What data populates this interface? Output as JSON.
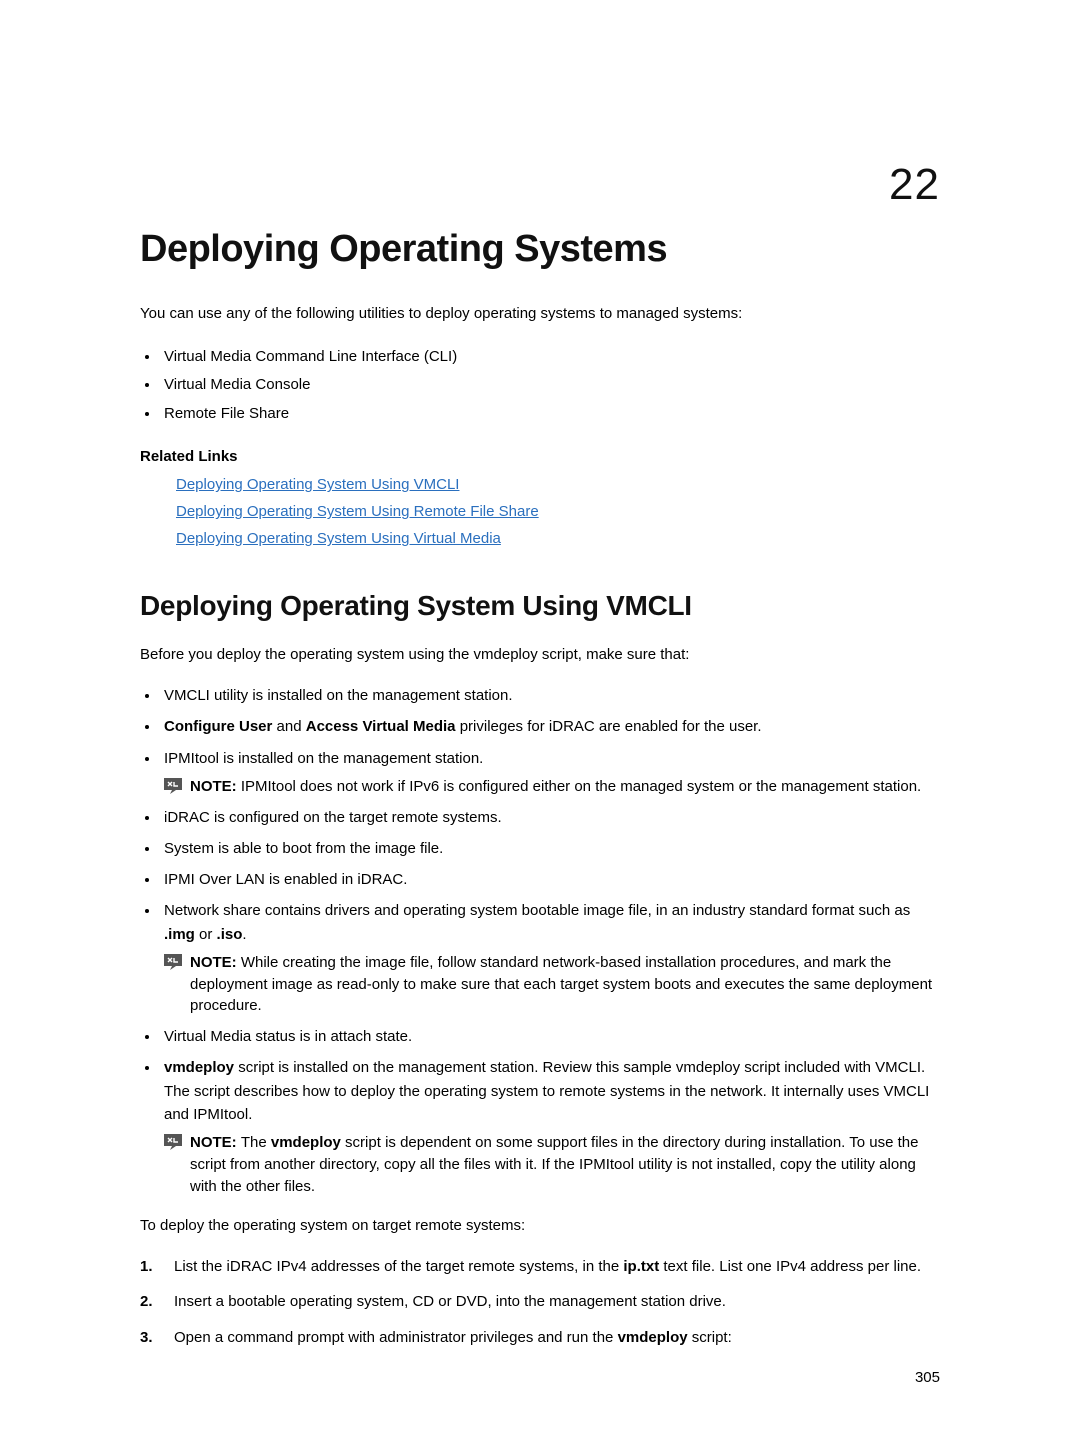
{
  "chapter_number": "22",
  "title": "Deploying Operating Systems",
  "intro": "You can use any of the following utilities to deploy operating systems to managed systems:",
  "top_bullets": [
    "Virtual Media Command Line Interface (CLI)",
    "Virtual Media Console",
    "Remote File Share"
  ],
  "related_heading": "Related Links",
  "related_links": [
    "Deploying Operating System Using VMCLI",
    "Deploying Operating System Using Remote File Share",
    "Deploying Operating System Using Virtual Media"
  ],
  "section_heading": "Deploying Operating System Using VMCLI",
  "section_intro": "Before you deploy the operating system using the vmdeploy script, make sure that:",
  "li1": "VMCLI utility is installed on the management station.",
  "li2_parts": {
    "b1": "Configure User",
    "mid": " and ",
    "b2": "Access Virtual Media",
    "tail": " privileges for iDRAC are enabled for the user."
  },
  "li3": "IPMItool is installed on the management station.",
  "note1": {
    "label": "NOTE: ",
    "text": "IPMItool does not work if IPv6 is configured either on the managed system or the management station."
  },
  "li4": "iDRAC is configured on the target remote systems.",
  "li5": "System is able to boot from the image file.",
  "li6": "IPMI Over LAN is enabled in iDRAC.",
  "li7": {
    "pre": "Network share contains drivers and operating system bootable image file, in an industry standard format such as ",
    "b1": ".img",
    "mid": " or ",
    "b2": ".iso",
    "tail": "."
  },
  "note2": {
    "label": "NOTE: ",
    "text": "While creating the image file, follow standard network-based installation procedures, and mark the deployment image as read-only to make sure that each target system boots and executes the same deployment procedure."
  },
  "li8": "Virtual Media status is in attach state.",
  "li9": {
    "b1": "vmdeploy",
    "tail": " script is installed on the management station. Review this sample vmdeploy script included with VMCLI. The script describes how to deploy the operating system to remote systems in the network. It internally uses VMCLI and IPMItool."
  },
  "note3": {
    "label": "NOTE: ",
    "pre": "The ",
    "b1": "vmdeploy",
    "text": " script is dependent on some support files in the directory during installation. To use the script from another directory, copy all the files with it. If the IPMItool utility is not installed, copy the utility along with the other files."
  },
  "deploy_intro": "To deploy the operating system on target remote systems:",
  "steps": {
    "s1": {
      "pre": "List the iDRAC IPv4 addresses of the target remote systems, in the ",
      "b1": "ip.txt",
      "tail": " text file. List one IPv4 address per line."
    },
    "s2": "Insert a bootable operating system, CD or DVD, into the management station drive.",
    "s3": {
      "pre": "Open a command prompt with administrator privileges and run the ",
      "b1": "vmdeploy",
      "tail": " script:"
    }
  },
  "page_number": "305"
}
